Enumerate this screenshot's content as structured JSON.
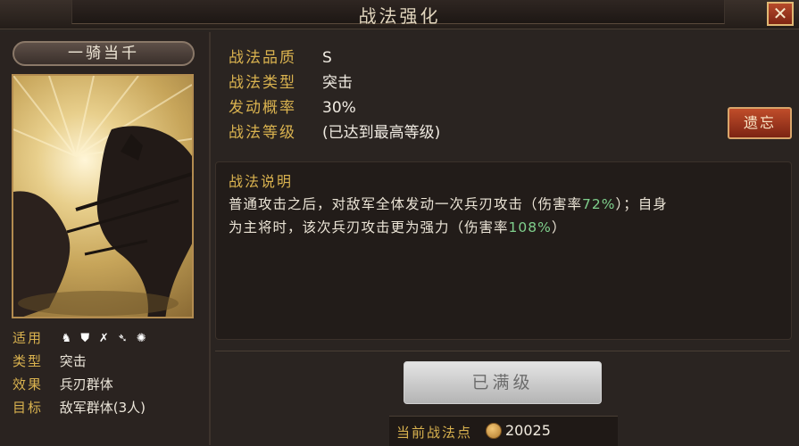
{
  "window": {
    "title": "战法强化",
    "close_glyph": "✕"
  },
  "skill": {
    "name": "一骑当千",
    "info": [
      {
        "key": "适用",
        "icons": [
          "cavalry-icon",
          "shield-icon",
          "archer-icon",
          "spear-icon",
          "siege-wheel-icon"
        ]
      },
      {
        "key": "类型",
        "value": "突击"
      },
      {
        "key": "效果",
        "value": "兵刃群体"
      },
      {
        "key": "目标",
        "value": "敌军群体(3人)"
      }
    ],
    "attributes": [
      {
        "key": "战法品质",
        "value": "S"
      },
      {
        "key": "战法类型",
        "value": "突击"
      },
      {
        "key": "发动概率",
        "value": "30%"
      },
      {
        "key": "战法等级",
        "value": "(已达到最高等级)"
      }
    ],
    "forget_label": "遗忘"
  },
  "description": {
    "title": "战法说明",
    "line1_a": "普通攻击之后，对敌军全体发动一次兵刃攻击（伤害率",
    "line1_hl": "72%",
    "line1_b": "）；自身",
    "line2_a": "为主将时，该次兵刃攻击更为强力（伤害率",
    "line2_hl": "108%",
    "line2_b": "）"
  },
  "max_button_label": "已满级",
  "points": {
    "label": "当前战法点",
    "value": "20025"
  },
  "colors": {
    "accent_gold": "#d9b24f",
    "highlight_green": "#7fcf8c",
    "button_red": "#c04d2a"
  }
}
